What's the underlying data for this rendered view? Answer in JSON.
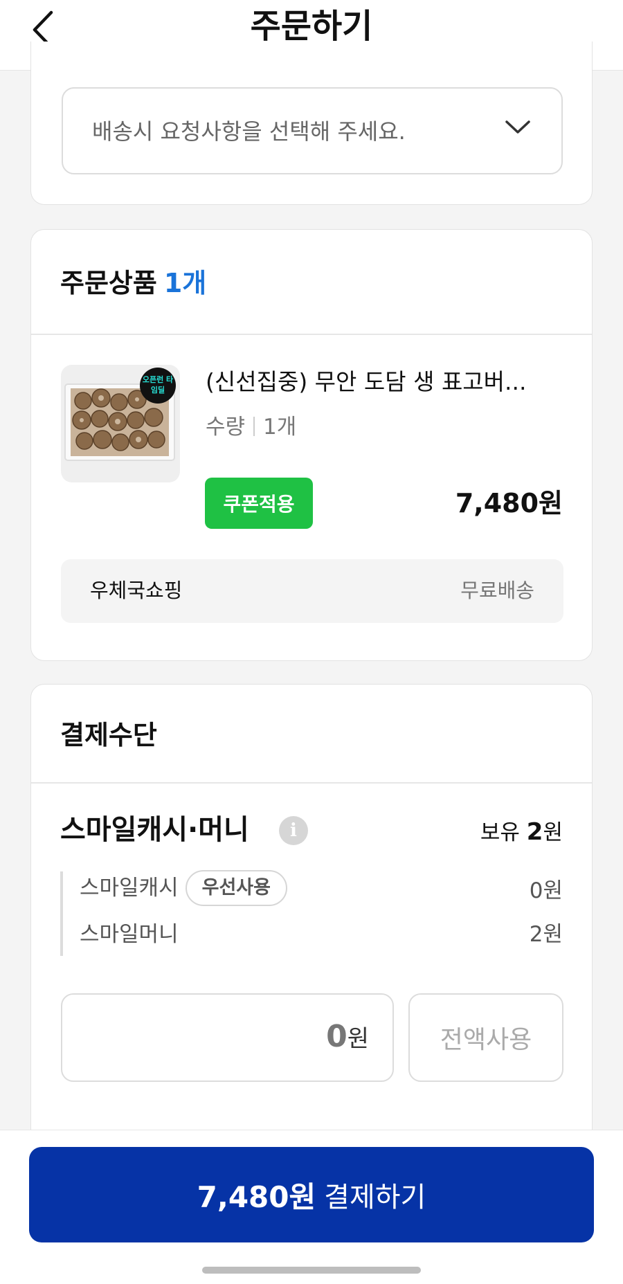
{
  "header": {
    "title": "주문하기",
    "back_icon": "chevron-left-icon"
  },
  "delivery": {
    "select_placeholder": "배송시 요청사항을 선택해 주세요.",
    "dropdown_icon": "chevron-down-icon"
  },
  "order": {
    "title": "주문상품",
    "count": "1개",
    "product": {
      "name": "(신선집중) 무안 도담 생 표고버...",
      "qty_label": "수량",
      "qty_value": "1개",
      "coupon_label": "쿠폰적용",
      "price": "7,480원",
      "thumb_badge": "오픈런 타임딜"
    },
    "seller": {
      "name": "우체국쇼핑",
      "shipping": "무료배송"
    }
  },
  "payment": {
    "title": "결제수단",
    "smile_title": "스마일캐시·머니",
    "info_icon": "info-icon",
    "holding_label": "보유",
    "holding_amount": "2",
    "holding_unit": "원",
    "items": [
      {
        "label": "스마일캐시",
        "badge": "우선사용",
        "value": "0원"
      },
      {
        "label": "스마일머니",
        "value": "2원"
      }
    ],
    "input_amount": "0",
    "input_unit": "원",
    "use_all_label": "전액사용"
  },
  "footer": {
    "pay_amount": "7,480원",
    "pay_label": "결제하기"
  },
  "colors": {
    "accent_blue": "#1a73d9",
    "pay_button": "#0633a6",
    "coupon_green": "#1fc144"
  }
}
